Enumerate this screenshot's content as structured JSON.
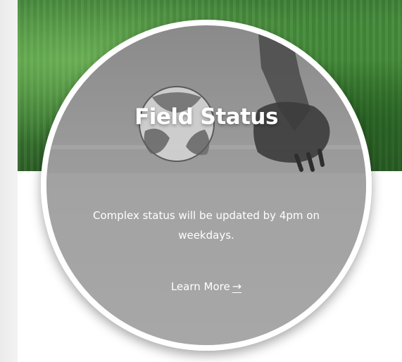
{
  "card": {
    "title": "Field Status",
    "description": "Complex status will be updated by 4pm on weekdays.",
    "link_label": "Learn More",
    "link_icon": "arrow-right-icon",
    "link_glyph": "→"
  },
  "colors": {
    "turf": "#4e9a40",
    "card_overlay": "#9a9a9a",
    "text": "#ffffff"
  }
}
